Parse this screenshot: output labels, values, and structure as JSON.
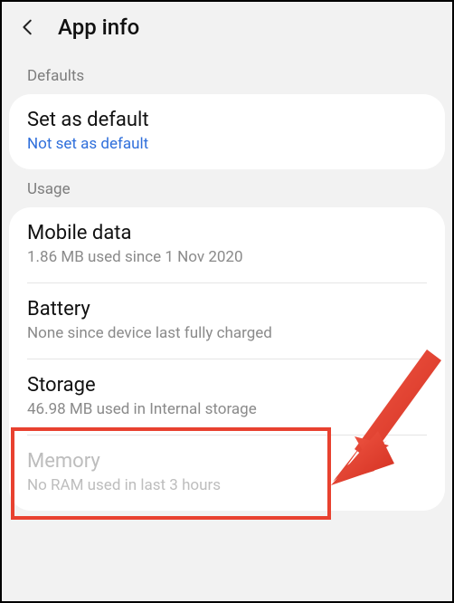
{
  "header": {
    "title": "App info"
  },
  "sections": {
    "defaults": {
      "label": "Defaults",
      "set_as_default": {
        "title": "Set as default",
        "sub": "Not set as default"
      }
    },
    "usage": {
      "label": "Usage",
      "mobile_data": {
        "title": "Mobile data",
        "sub": "1.86 MB used since 1 Nov 2020"
      },
      "battery": {
        "title": "Battery",
        "sub": "None since device last fully charged"
      },
      "storage": {
        "title": "Storage",
        "sub": "46.98 MB used in Internal storage"
      },
      "memory": {
        "title": "Memory",
        "sub": "No RAM used in last 3 hours"
      }
    }
  }
}
